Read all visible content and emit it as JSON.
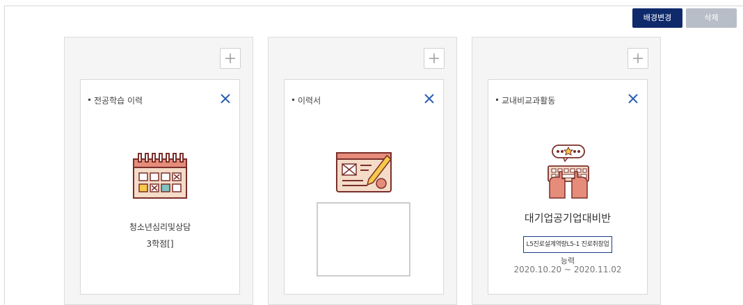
{
  "toolbar": {
    "change_background_label": "배경변경",
    "delete_label": "삭제"
  },
  "columns": [
    {
      "card_title": "전공학습 이력",
      "icon": "calendar-icon",
      "line1": "청소년심리및상담",
      "line2": "3학점[]"
    },
    {
      "card_title": "이력서",
      "icon": "resume-pen-icon"
    },
    {
      "card_title": "교내비교과활동",
      "icon": "keyboard-typing-icon",
      "program_title": "대기업공기업대비반",
      "competency_tag": "L5진로설계역량L5-1 진로취창업",
      "competency_suffix": "능력",
      "period": "2020.10.20 ~ 2020.11.02"
    }
  ],
  "colors": {
    "primary_button": "#0f2a6b",
    "disabled_button": "#b7bec7",
    "close_icon": "#2b5fb3",
    "icon_outline": "#7a2e2a"
  }
}
